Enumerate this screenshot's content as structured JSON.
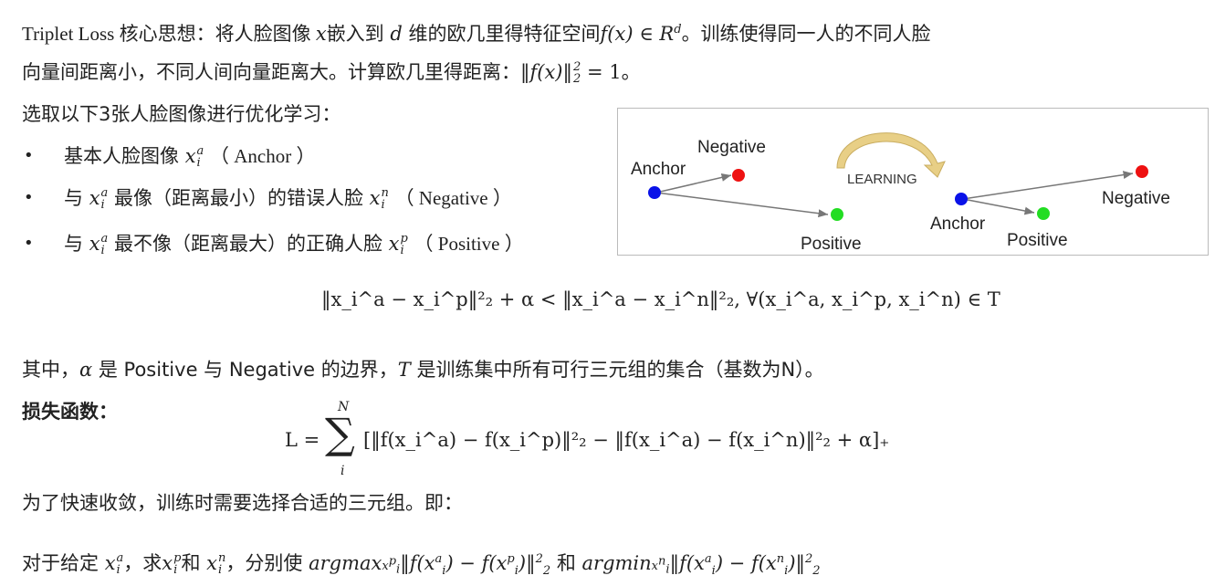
{
  "intro": {
    "line1_a": "Triplet Loss 核心思想：将人脸图像 ",
    "x": "x",
    "line1_b": "嵌入到 ",
    "d": "d",
    "line1_c": " 维的欧几里得特征空间",
    "fx": "f(x) ∈ R",
    "sup_d": "d",
    "line1_d": "。训练使得同一人的不同人脸",
    "line2_a": "向量间距离小，不同人间向量距离大。计算欧几里得距离：",
    "line2_math": "‖f(x)‖",
    "line2_sup": "2",
    "line2_sub": "2",
    "line2_eq": " = 1",
    "line2_end": "。"
  },
  "select_heading": "选取以下3张人脸图像进行优化学习：",
  "bullets": [
    {
      "pre": "基本人脸图像 ",
      "var": "x",
      "sup": "a",
      "sub": "i",
      "mid": "",
      "label": "（ Anchor ）"
    },
    {
      "pre": "与 ",
      "var": "x",
      "sup": "a",
      "sub": "i",
      "mid": " 最像（距离最小）的错误人脸 ",
      "var2": "x",
      "sup2": "n",
      "sub2": "i",
      "label": "（ Negative ）"
    },
    {
      "pre": "与 ",
      "var": "x",
      "sup": "a",
      "sub": "i",
      "mid": " 最不像（距离最大）的正确人脸 ",
      "var2": "x",
      "sup2": "p",
      "sub2": "i",
      "label": "（ Positive ）"
    }
  ],
  "bullet_symbol": "•",
  "diagram": {
    "left": {
      "anchor": "Anchor",
      "negative": "Negative",
      "positive": "Positive"
    },
    "learning": "LEARNING",
    "right": {
      "anchor": "Anchor",
      "negative": "Negative",
      "positive": "Positive"
    },
    "colors": {
      "anchor": "#0a12e8",
      "negative": "#ee1111",
      "positive": "#22dd22",
      "arrow": "#777777",
      "learning_arrow": "#e8cf86"
    }
  },
  "constraint": "‖x_i^a − x_i^p‖²₂ + α < ‖x_i^a − x_i^n‖²₂, ∀(x_i^a, x_i^p, x_i^n) ∈ T",
  "where_line": {
    "a": "其中，",
    "alpha": "α",
    "b": " 是 Positive 与 Negative 的边界，",
    "T": "T",
    "c": " 是训练集中所有可行三元组的集合（基数为N）。"
  },
  "loss_label": "损失函数：",
  "loss": {
    "L": "L = ",
    "sum_top": "N",
    "sum_bottom": "i",
    "sum": "∑",
    "body": "[‖f(x_i^a) − f(x_i^p)‖²₂ − ‖f(x_i^a) − f(x_i^n)‖²₂ + α]₊"
  },
  "converge_line": "为了快速收敛，训练时需要选择合适的三元组。即：",
  "final_line": {
    "a": "对于给定 ",
    "b": "，求",
    "c": "和 ",
    "d": "，分别使 ",
    "argmax": "argmax",
    "e": " 和 ",
    "argmin": "argmin"
  }
}
